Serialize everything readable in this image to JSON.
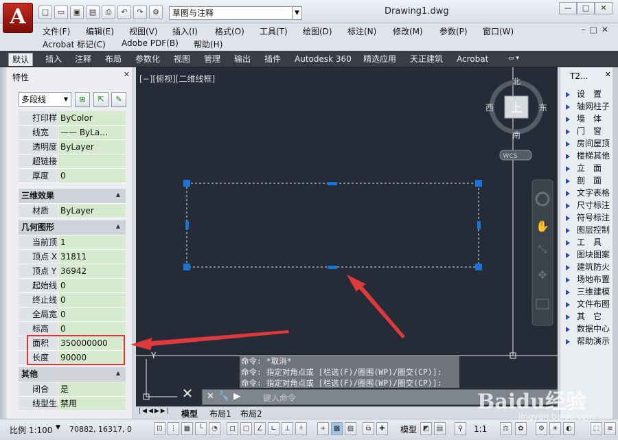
{
  "app": {
    "logo": "A",
    "document_title": "Drawing1.dwg",
    "workspace": "草图与注释",
    "window_controls": [
      "—",
      "□",
      "✕"
    ],
    "doc_controls": "–□✕"
  },
  "menu": {
    "row1": [
      "文件(F)",
      "编辑(E)",
      "视图(V)",
      "插入(I)",
      "格式(O)",
      "工具(T)",
      "绘图(D)",
      "标注(N)",
      "修改(M)",
      "参数(P)",
      "窗口(W)"
    ],
    "row2": [
      "Acrobat 标记(C)",
      "Adobe PDF(B)",
      "帮助(H)"
    ]
  },
  "ribbon": {
    "tabs": [
      "默认",
      "插入",
      "注释",
      "布局",
      "参数化",
      "视图",
      "管理",
      "输出",
      "插件",
      "Autodesk 360",
      "精选应用",
      "天正建筑",
      "Acrobat"
    ],
    "active_tab": "默认"
  },
  "properties": {
    "title": "特性",
    "object_type": "多段线",
    "rows_top": [
      {
        "key": "打印样式",
        "value": "ByColor"
      },
      {
        "key": "线宽",
        "value": "—— ByLa..."
      },
      {
        "key": "透明度",
        "value": "ByLayer"
      },
      {
        "key": "超链接",
        "value": ""
      },
      {
        "key": "厚度",
        "value": "0"
      }
    ],
    "section_3d": "三维效果",
    "rows_3d": [
      {
        "key": "材质",
        "value": "ByLayer"
      }
    ],
    "section_geom": "几何图形",
    "rows_geom": [
      {
        "key": "当前顶点",
        "value": "1"
      },
      {
        "key": "顶点 X ...",
        "value": "31811"
      },
      {
        "key": "顶点 Y ...",
        "value": "36942"
      },
      {
        "key": "起始线...",
        "value": "0"
      },
      {
        "key": "终止线...",
        "value": "0"
      },
      {
        "key": "全局宽度",
        "value": "0"
      },
      {
        "key": "标高",
        "value": "0"
      },
      {
        "key": "面积",
        "value": "350000000"
      },
      {
        "key": "长度",
        "value": "90000"
      }
    ],
    "section_other": "其他",
    "rows_other": [
      {
        "key": "闭合",
        "value": "是"
      },
      {
        "key": "线型生成",
        "value": "禁用"
      }
    ]
  },
  "viewport": {
    "label": "[−][俯视][二维线框]",
    "viewcube": {
      "north": "北",
      "south": "南",
      "east": "东",
      "west": "西",
      "top": "上",
      "wcs": "WCS"
    },
    "ucs_y": "Y"
  },
  "command": {
    "history": [
      "命令: *取消*",
      "命令: 指定对角点或 [栏选(F)/圈围(WP)/圈交(CP)]:",
      "命令: 指定对角点或 [栏选(F)/圈围(WP)/圈交(CP)]:"
    ],
    "placeholder": "键入命令"
  },
  "layouts": {
    "tabs": [
      "模型",
      "布局1",
      "布局2"
    ]
  },
  "status": {
    "scale": "比例 1:100",
    "coords": "70882, 16317, 0",
    "model": "模型",
    "anno_scale": "1:1"
  },
  "tool_palette": {
    "title": "T2...",
    "items": [
      "设　置",
      "轴网柱子",
      "墙　体",
      "门　窗",
      "房间屋顶",
      "楼梯其他",
      "立　面",
      "剖　面",
      "文字表格",
      "尺寸标注",
      "符号标注",
      "图层控制",
      "工　具",
      "图块图案",
      "建筑防火",
      "场地布置",
      "三维建模",
      "文件布图",
      "其　它",
      "数据中心",
      "帮助演示"
    ]
  },
  "watermark": {
    "text": "Baidu经验",
    "sub": "jingyan.baidu.com"
  },
  "colors": {
    "canvas": "#252c37",
    "highlight": "#d9363a",
    "grip": "#1a73d9",
    "palette_value": "#d6ebcd"
  }
}
